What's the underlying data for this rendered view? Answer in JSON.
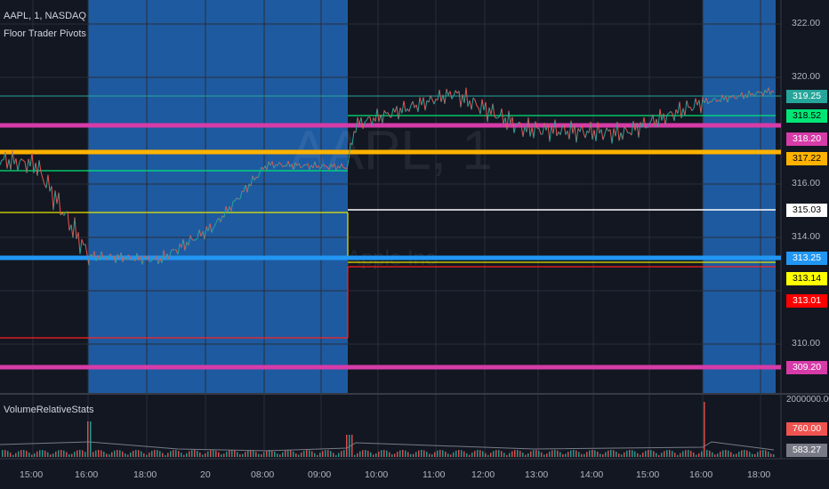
{
  "header": {
    "symbol_line": "AAPL, 1, NASDAQ",
    "indicator": "Floor Trader Pivots",
    "volume_indicator": "VolumeRelativeStats"
  },
  "watermark": {
    "ticker": "AAPL, 1",
    "company": "Apple Inc"
  },
  "price_axis": {
    "ticks": [
      "322.00",
      "320.00",
      "316.00",
      "314.00",
      "310.00"
    ]
  },
  "time_axis": {
    "ticks": [
      "15:00",
      "16:00",
      "18:00",
      "20",
      "08:00",
      "09:00",
      "10:00",
      "11:00",
      "12:00",
      "13:00",
      "14:00",
      "15:00",
      "16:00",
      "18:00"
    ]
  },
  "pivot_tags": [
    {
      "label": "319.25",
      "bg": "#26a69a",
      "fg": "#ffffff"
    },
    {
      "label": "318.52",
      "bg": "#00e676",
      "fg": "#000000"
    },
    {
      "label": "318.20",
      "bg": "#d63ba8",
      "fg": "#ffffff"
    },
    {
      "label": "317.22",
      "bg": "#ffb300",
      "fg": "#000000"
    },
    {
      "label": "315.03",
      "bg": "#ffffff",
      "fg": "#000000"
    },
    {
      "label": "313.25",
      "bg": "#2196f3",
      "fg": "#ffffff"
    },
    {
      "label": "313.14",
      "bg": "#ffff00",
      "fg": "#000000"
    },
    {
      "label": "313.01",
      "bg": "#ff0000",
      "fg": "#ffffff"
    },
    {
      "label": "309.20",
      "bg": "#d63ba8",
      "fg": "#ffffff"
    }
  ],
  "volume_axis": {
    "top": "2000000.00",
    "mid": {
      "label": "760.00",
      "bg": "#ef5350",
      "fg": "#ffffff"
    },
    "bottom": {
      "label": "583.27",
      "bg": "#787b86",
      "fg": "#ffffff"
    }
  },
  "colors": {
    "background": "#131722",
    "session_shade": "#1e5aa0",
    "grid": "#2a2e39",
    "candle_up": "#26a69a",
    "candle_down": "#ef5350"
  }
}
